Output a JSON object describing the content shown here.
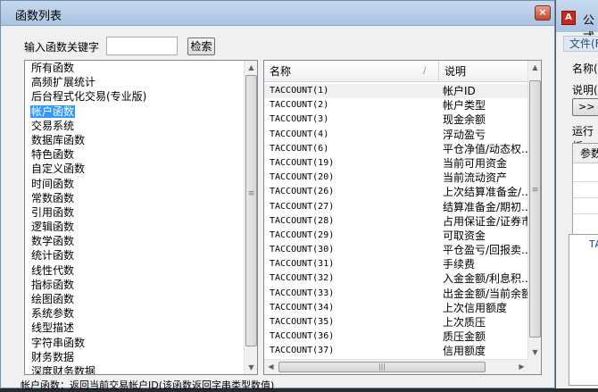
{
  "dialog": {
    "title": "函数列表",
    "close_label": "×",
    "search_label": "输入函数关键字",
    "search_value": "",
    "search_button": "检索"
  },
  "categories": [
    {
      "label": "所有函数",
      "selected": false
    },
    {
      "label": "高频扩展统计",
      "selected": false
    },
    {
      "label": "后台程式化交易(专业版)",
      "selected": false
    },
    {
      "label": "帐户函数",
      "selected": true
    },
    {
      "label": "交易系统",
      "selected": false
    },
    {
      "label": "数据库函数",
      "selected": false
    },
    {
      "label": "特色函数",
      "selected": false
    },
    {
      "label": "自定义函数",
      "selected": false
    },
    {
      "label": "时间函数",
      "selected": false
    },
    {
      "label": "常数函数",
      "selected": false
    },
    {
      "label": "引用函数",
      "selected": false
    },
    {
      "label": "逻辑函数",
      "selected": false
    },
    {
      "label": "数学函数",
      "selected": false
    },
    {
      "label": "统计函数",
      "selected": false
    },
    {
      "label": "线性代数",
      "selected": false
    },
    {
      "label": "指标函数",
      "selected": false
    },
    {
      "label": "绘图函数",
      "selected": false
    },
    {
      "label": "系统参数",
      "selected": false
    },
    {
      "label": "线型描述",
      "selected": false
    },
    {
      "label": "字符串函数",
      "selected": false
    },
    {
      "label": "财务数据",
      "selected": false
    },
    {
      "label": "深度财务数据",
      "selected": false
    }
  ],
  "table": {
    "col_name": "名称",
    "col_desc": "说明",
    "sort_mark": "/",
    "rows": [
      {
        "name": "TACCOUNT(1)",
        "desc": "帐户ID"
      },
      {
        "name": "TACCOUNT(2)",
        "desc": "帐户类型"
      },
      {
        "name": "TACCOUNT(3)",
        "desc": "现金余额"
      },
      {
        "name": "TACCOUNT(4)",
        "desc": "浮动盈亏"
      },
      {
        "name": "TACCOUNT(6)",
        "desc": "平仓净值/动态权..."
      },
      {
        "name": "TACCOUNT(19)",
        "desc": "当前可用资金"
      },
      {
        "name": "TACCOUNT(20)",
        "desc": "当前流动资产"
      },
      {
        "name": "TACCOUNT(26)",
        "desc": "上次结算准备金/..."
      },
      {
        "name": "TACCOUNT(27)",
        "desc": "结算准备金/期初..."
      },
      {
        "name": "TACCOUNT(28)",
        "desc": "占用保证金/证券市..."
      },
      {
        "name": "TACCOUNT(29)",
        "desc": "可取资金"
      },
      {
        "name": "TACCOUNT(30)",
        "desc": "平仓盈亏/回报卖..."
      },
      {
        "name": "TACCOUNT(31)",
        "desc": "手续费"
      },
      {
        "name": "TACCOUNT(32)",
        "desc": "入金金额/利息积..."
      },
      {
        "name": "TACCOUNT(33)",
        "desc": "出金金额/当前余额..."
      },
      {
        "name": "TACCOUNT(34)",
        "desc": "上次信用额度"
      },
      {
        "name": "TACCOUNT(35)",
        "desc": "上次质压"
      },
      {
        "name": "TACCOUNT(36)",
        "desc": "质压金额"
      },
      {
        "name": "TACCOUNT(37)",
        "desc": "信用额度"
      }
    ]
  },
  "status": "帐户函数：返回当前交易帐户ID(该函数返回字串类型数值)",
  "background_window": {
    "title": "公式",
    "app_icon": "A",
    "menu": "文件(F)",
    "name_label": "名称(",
    "desc_label": "说明(",
    "expand_button": ">>",
    "run_label": "运行板",
    "param_header": "参数",
    "code_text": "TA"
  }
}
